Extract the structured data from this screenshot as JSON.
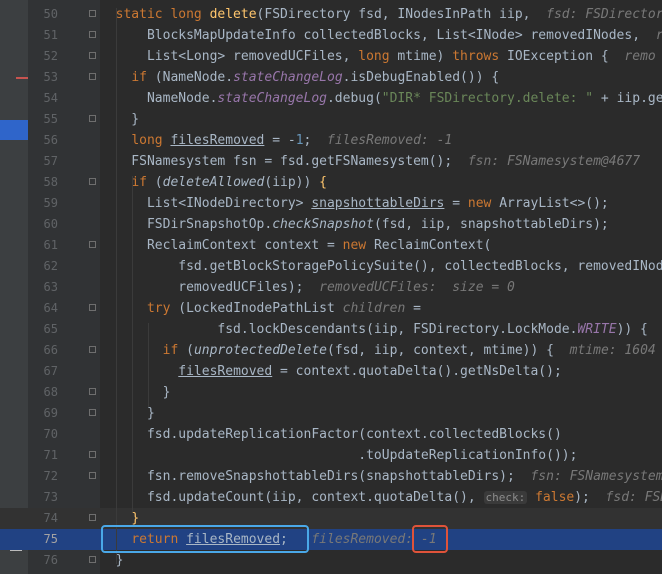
{
  "lines": [
    {
      "n": "50",
      "html": "  <span class=\"kw\">static long </span><span class=\"fn\">delete</span>(FSDirectory fsd, INodesInPath iip,  <span class=\"hint\">fsd: FSDirectory@</span>"
    },
    {
      "n": "51",
      "html": "      BlocksMapUpdateInfo collectedBlocks, List&lt;INode&gt; removedINodes,  <span class=\"hint\">r</span>"
    },
    {
      "n": "52",
      "html": "      List&lt;Long&gt; removedUCFiles, <span class=\"kw\">long </span>mtime) <span class=\"kw\">throws </span>IOException {  <span class=\"hint\">remo</span>"
    },
    {
      "n": "53",
      "html": "    <span class=\"kw\">if </span>(NameNode.<span class=\"st\">stateChangeLog</span>.isDebugEnabled()) {"
    },
    {
      "n": "54",
      "html": "      NameNode.<span class=\"st\">stateChangeLog</span>.debug(<span class=\"str\">\"DIR* FSDirectory.delete: \"</span> + iip.get"
    },
    {
      "n": "55",
      "html": "    }"
    },
    {
      "n": "56",
      "html": "    <span class=\"kw\">long </span><span class=\"ul\">filesRemoved</span> = -<span class=\"num\">1</span>;  <span class=\"hint\">filesRemoved: -1</span>"
    },
    {
      "n": "57",
      "html": "    FSNamesystem fsn = fsd.getFSNamesystem();  <span class=\"hint\">fsn: FSNamesystem@4677</span>"
    },
    {
      "n": "58",
      "html": "    <span class=\"kw\">if </span>(<span class=\"it\">deleteAllowed</span>(iip)) <span class=\"fn\">{</span>"
    },
    {
      "n": "59",
      "html": "      List&lt;INodeDirectory&gt; <span class=\"ul\">snapshottableDirs</span> = <span class=\"kw\">new </span>ArrayList&lt;&gt;();"
    },
    {
      "n": "60",
      "html": "      FSDirSnapshotOp.<span class=\"it\">checkSnapshot</span>(fsd, iip, snapshottableDirs);"
    },
    {
      "n": "61",
      "html": "      ReclaimContext context = <span class=\"kw\">new </span>ReclaimContext("
    },
    {
      "n": "62",
      "html": "          fsd.getBlockStoragePolicySuite(), collectedBlocks, removedINod"
    },
    {
      "n": "63",
      "html": "          removedUCFiles);  <span class=\"hint\">removedUCFiles:  size = 0</span>"
    },
    {
      "n": "64",
      "html": "      <span class=\"kw\">try </span>(LockedInodePathList <span class=\"hint\">children</span> ="
    },
    {
      "n": "65",
      "html": "               fsd.lockDescendants(iip, FSDirectory.LockMode.<span class=\"st\">WRITE</span>)) {"
    },
    {
      "n": "66",
      "html": "        <span class=\"kw\">if </span>(<span class=\"it\">unprotectedDelete</span>(fsd, iip, context, mtime)) {  <span class=\"hint\">mtime: 1604</span>"
    },
    {
      "n": "67",
      "html": "          <span class=\"ul\">filesRemoved</span> = context.quotaDelta().getNsDelta();"
    },
    {
      "n": "68",
      "html": "        }"
    },
    {
      "n": "69",
      "html": "      }"
    },
    {
      "n": "70",
      "html": "      fsd.updateReplicationFactor(context.collectedBlocks()"
    },
    {
      "n": "71",
      "html": "                                 .toUpdateReplicationInfo());"
    },
    {
      "n": "72",
      "html": "      fsn.removeSnapshottableDirs(snapshottableDirs);  <span class=\"hint\">fsn: FSNamesystem</span>"
    },
    {
      "n": "73",
      "html": "      fsd.updateCount(iip, context.quotaDelta(), <span class=\"chk\">check:</span> <span class=\"kw\">false</span>);  <span class=\"hint\">fsd: FSD</span>"
    },
    {
      "n": "74",
      "html": "    <span class=\"fn\">}</span>"
    },
    {
      "n": "75",
      "html": "    <span class=\"kw\">return </span><span class=\"ul\">filesRemoved</span>;   <span class=\"hint\">filesRemoved:</span> <span class=\"hint\">-1</span>"
    },
    {
      "n": "76",
      "html": "  }"
    }
  ],
  "colors": {
    "highlight": "#214283",
    "callout_blue": "#4aa8e8",
    "callout_red": "#e0533a"
  }
}
